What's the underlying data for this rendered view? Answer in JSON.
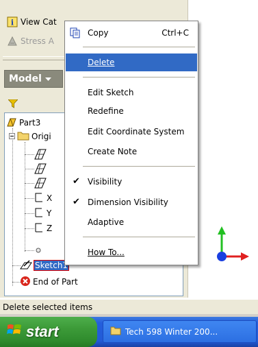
{
  "panel": {
    "view_catalog_label": "View Cat",
    "stress_label": "Stress A",
    "model_label": "Model",
    "tree": {
      "part": "Part3",
      "origin": "Origi",
      "axis_letters": [
        "X",
        "Y",
        "Z"
      ],
      "sketch": "Sketch1",
      "end": "End of Part"
    }
  },
  "context_menu": {
    "copy_label": "Copy",
    "copy_shortcut": "Ctrl+C",
    "delete_label": "Delete",
    "edit_sketch_label": "Edit Sketch",
    "redefine_label": "Redefine",
    "edit_coord_label": "Edit Coordinate System",
    "create_note_label": "Create Note",
    "visibility_label": "Visibility",
    "dimension_visibility_label": "Dimension Visibility",
    "adaptive_label": "Adaptive",
    "how_to_label": "How To..."
  },
  "status_text": "Delete selected items",
  "taskbar": {
    "start_label": "start",
    "task_label": "Tech 598 Winter 200..."
  },
  "colors": {
    "highlight": "#316ac5",
    "taskbar_blue": "#245edc",
    "start_green": "#3c9a38",
    "axis_green": "#22c022",
    "axis_red": "#e02020",
    "axis_blue": "#1a3fe0"
  },
  "icons": [
    "info-icon",
    "stress-icon",
    "copy-icon",
    "filter-icon",
    "part-icon",
    "folder-icon",
    "plane-icon",
    "sketch-icon",
    "error-icon",
    "windows-logo-icon",
    "folder-task-icon",
    "axis-triad-icon",
    "dropdown-arrow-icon"
  ]
}
